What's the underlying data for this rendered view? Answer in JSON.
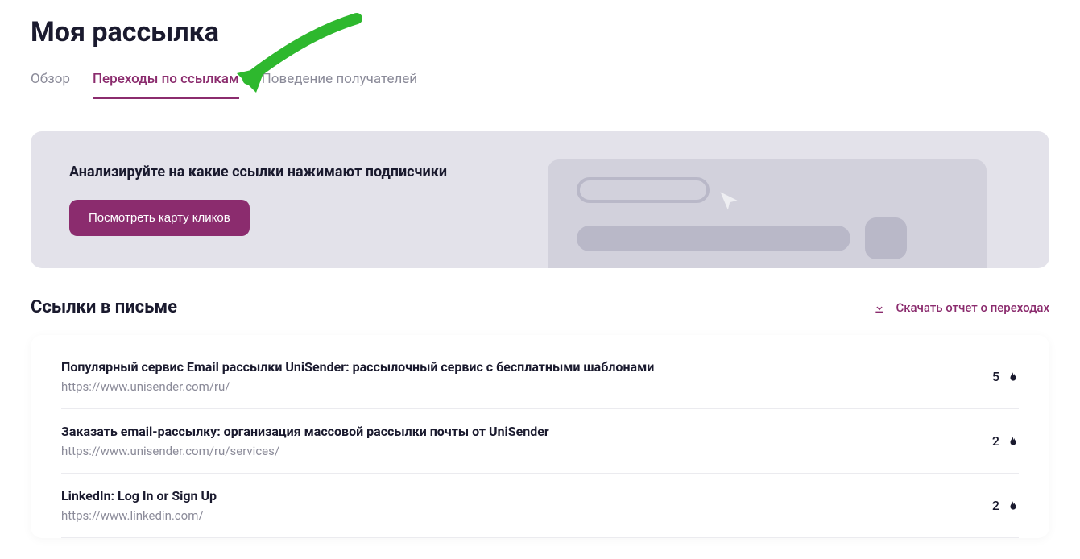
{
  "page_title": "Моя рассылка",
  "tabs": [
    {
      "label": "Обзор",
      "active": false
    },
    {
      "label": "Переходы по ссылкам",
      "active": true
    },
    {
      "label": "Поведение получателей",
      "active": false
    }
  ],
  "banner": {
    "title": "Анализируйте на какие ссылки нажимают подписчики",
    "button_label": "Посмотреть карту кликов"
  },
  "section": {
    "title": "Ссылки в письме",
    "download_label": "Скачать отчет о переходах"
  },
  "links": [
    {
      "title": "Популярный сервис Email рассылки UniSender: рассылочный сервис с бесплатными шаблонами",
      "url": "https://www.unisender.com/ru/",
      "count": "5"
    },
    {
      "title": "Заказать email-рассылку: организация массовой рассылки почты от UniSender",
      "url": "https://www.unisender.com/ru/services/",
      "count": "2"
    },
    {
      "title": "LinkedIn: Log In or Sign Up",
      "url": "https://www.linkedin.com/",
      "count": "2"
    }
  ],
  "colors": {
    "accent": "#8b2c6e",
    "annotation_arrow": "#2eb82e"
  }
}
